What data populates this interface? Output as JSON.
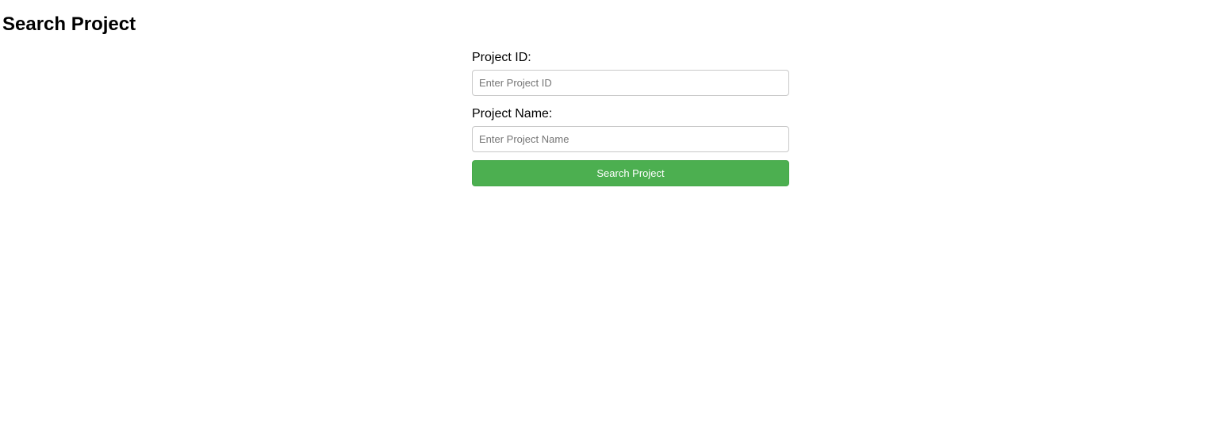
{
  "page": {
    "title": "Search Project"
  },
  "form": {
    "project_id": {
      "label": "Project ID:",
      "value": "",
      "placeholder": "Enter Project ID"
    },
    "project_name": {
      "label": "Project Name:",
      "value": "",
      "placeholder": "Enter Project Name"
    },
    "submit_label": "Search Project"
  },
  "colors": {
    "button_background": "#4caf50",
    "button_text": "#ffffff",
    "input_border": "#c8c8c8"
  }
}
